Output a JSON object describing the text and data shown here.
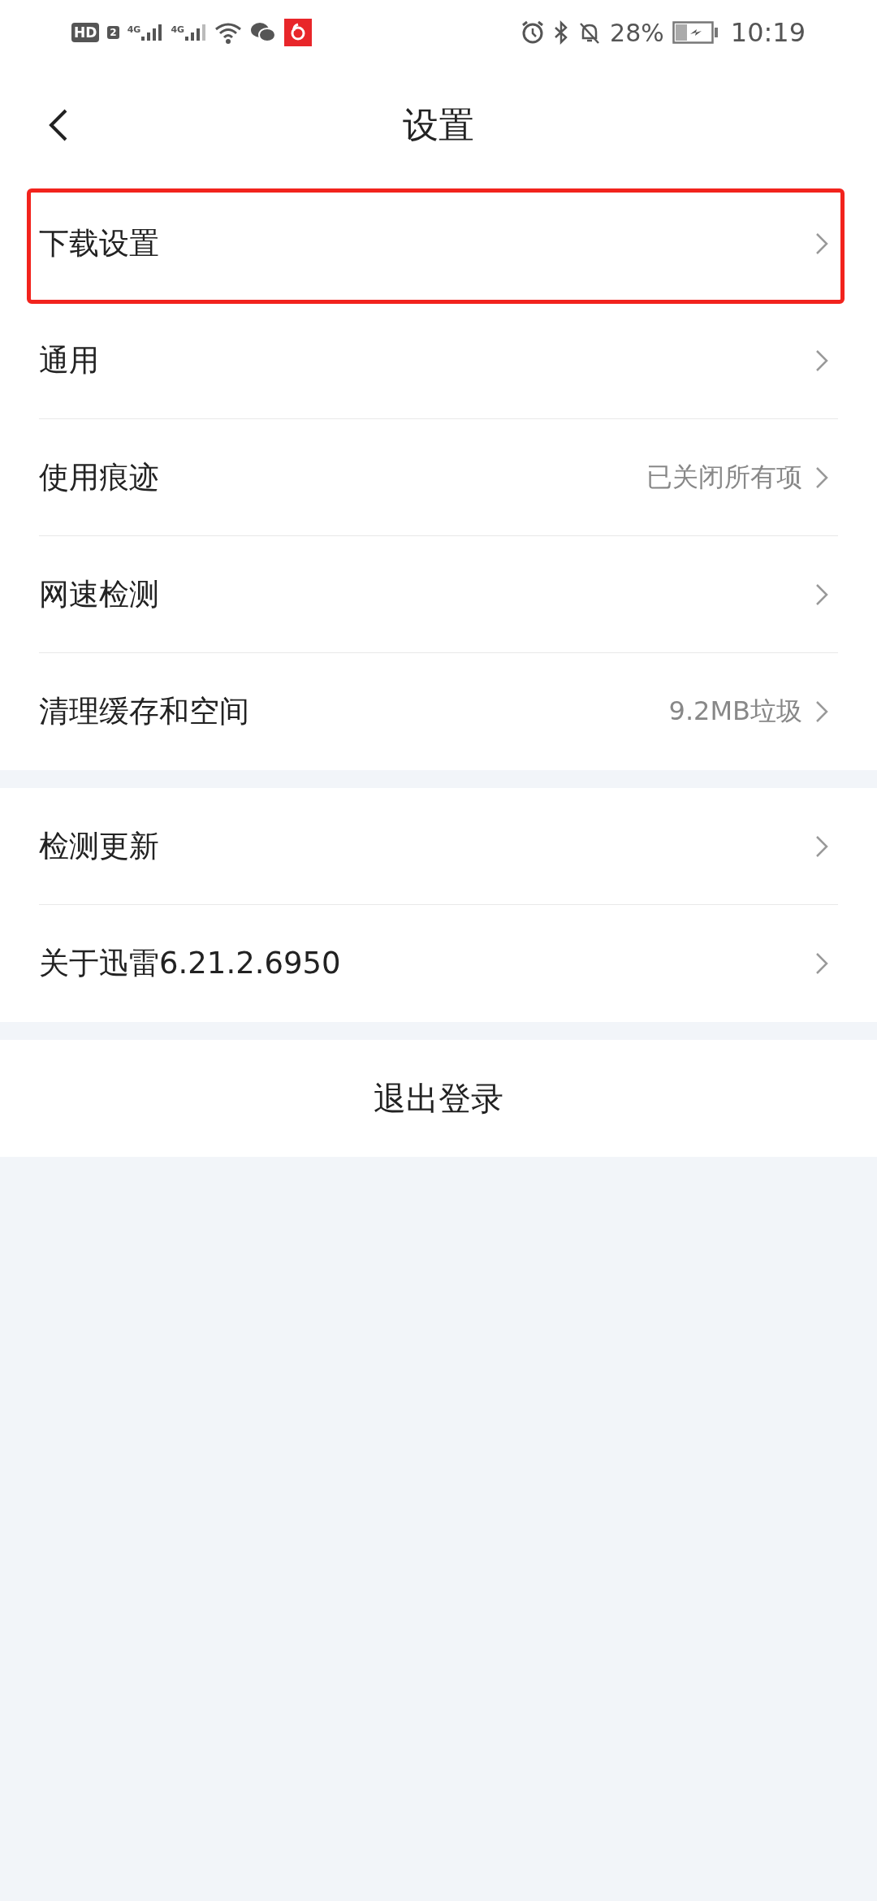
{
  "status_bar": {
    "hd": "HD",
    "sim": "2",
    "network_1": "4G",
    "network_2": "4G",
    "battery": "28%",
    "time": "10:19"
  },
  "header": {
    "title": "设置"
  },
  "groups": [
    {
      "items": [
        {
          "label": "下载设置",
          "highlighted": true
        },
        {
          "label": "通用",
          "highlighted": false
        },
        {
          "label": "使用痕迹",
          "value": "已关闭所有项",
          "highlighted": false
        },
        {
          "label": "网速检测",
          "highlighted": false
        },
        {
          "label": "清理缓存和空间",
          "value": "9.2MB垃圾",
          "highlighted": false
        }
      ]
    },
    {
      "items": [
        {
          "label": "检测更新",
          "highlighted": false
        },
        {
          "label": "关于迅雷6.21.2.6950",
          "highlighted": false
        }
      ]
    }
  ],
  "logout_button": "退出登录"
}
